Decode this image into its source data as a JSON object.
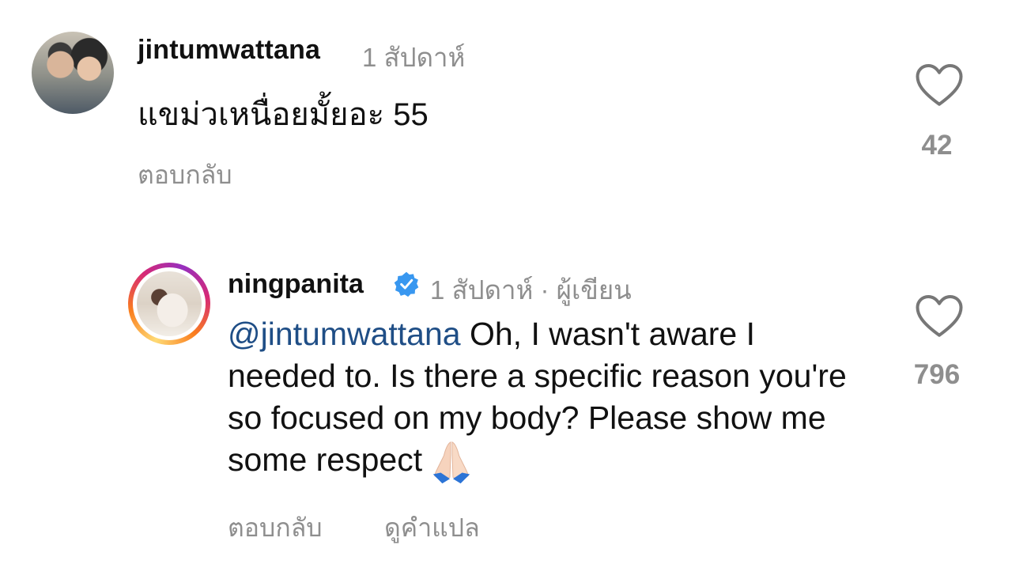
{
  "comments": [
    {
      "username": "jintumwattana",
      "time": "1 สัปดาห์",
      "text": "แขม่วเหนื่อยมั้ยอะ 55",
      "reply_label": "ตอบกลับ",
      "likes": "42",
      "like_icon": "heart-outline-icon",
      "avatar_icon": "user-avatar"
    },
    {
      "username": "ningpanita",
      "verified_icon": "verified-badge-icon",
      "meta": "1 สัปดาห์ · ผู้เขียน",
      "mention": "@jintumwattana",
      "text": " Oh, I wasn't aware I needed to.  Is there a specific reason you're so focused on my body? Please show me some respect",
      "emoji_icon": "folded-hands-emoji",
      "reply_label": "ตอบกลับ",
      "translate_label": "ดูคำแปล",
      "likes": "796",
      "like_icon": "heart-outline-icon",
      "avatar_icon": "user-avatar-story-ring"
    }
  ],
  "colors": {
    "text": "#111111",
    "muted": "#8e8e8e",
    "mention": "#1f4e86",
    "verified": "#3897f0"
  }
}
